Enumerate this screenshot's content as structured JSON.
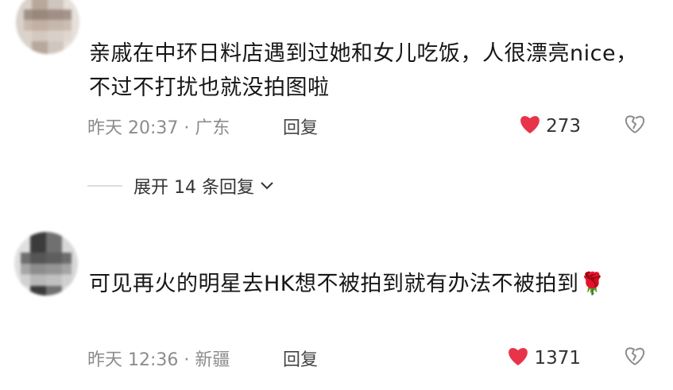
{
  "comments": [
    {
      "text": "亲戚在中环日料店遇到过她和女儿吃饭，人很漂亮nice，不过不打扰也就没拍图啦",
      "time_location": "昨天 20:37 · 广东",
      "reply_label": "回复",
      "likes": "273",
      "expand_label": "展开 14 条回复"
    },
    {
      "text": "可见再火的明星去HK想不被拍到就有办法不被拍到",
      "emoji": "🌹",
      "time_location": "昨天 12:36 · 新疆",
      "reply_label": "回复",
      "likes": "1371"
    }
  ],
  "colors": {
    "like_heart": "#e8344a",
    "meta_text": "#8c8c8c"
  },
  "icons": {
    "like": "heart-icon",
    "dislike": "broken-heart-icon",
    "expand": "chevron-down-icon"
  }
}
